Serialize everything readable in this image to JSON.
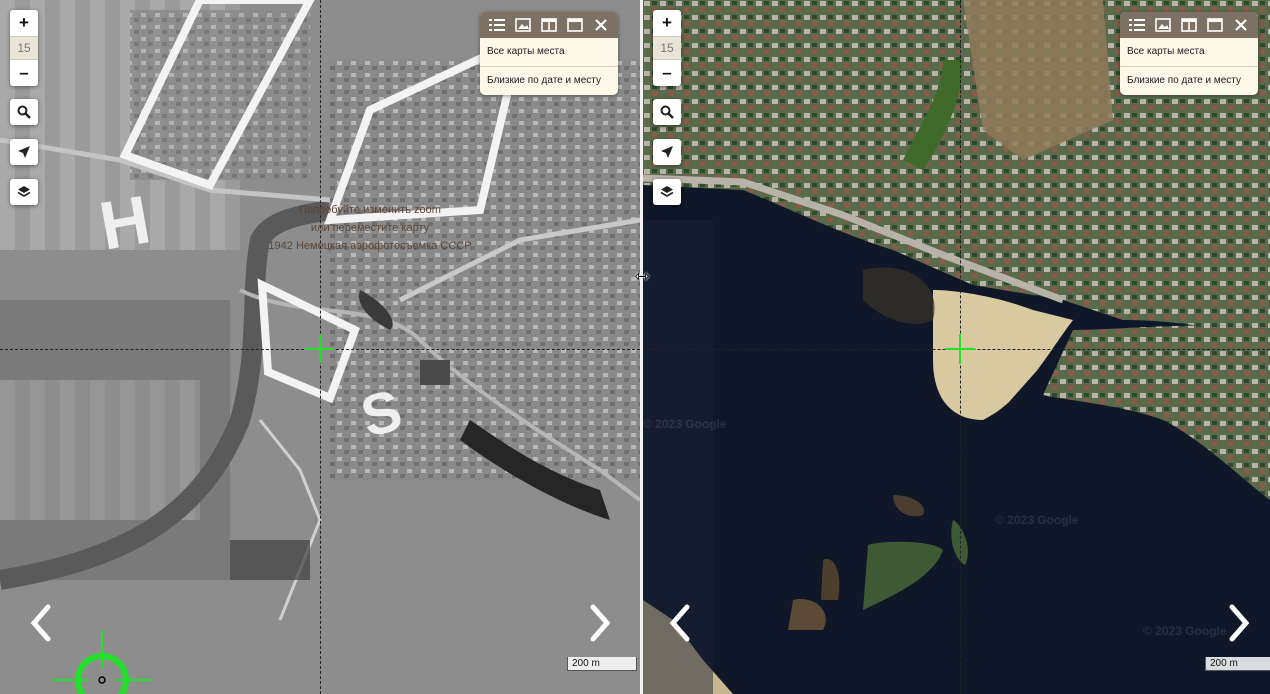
{
  "left_map": {
    "zoom_in": "+",
    "zoom_level": "15",
    "zoom_out": "–",
    "hint_lines": [
      "Попробуйте изменить zoom",
      "или переместите карту",
      "1942 Немецкая аэрофотосъемка СССР"
    ],
    "scale_label": "200 m",
    "panel": {
      "link_all_maps": "Все карты места",
      "link_nearby": "Близкие по дате и месту"
    }
  },
  "right_map": {
    "zoom_in": "+",
    "zoom_level": "15",
    "zoom_out": "–",
    "scale_label": "200 m",
    "watermark": "© 2023 Google",
    "panel": {
      "link_all_maps": "Все карты места",
      "link_nearby": "Близкие по дате и месту"
    }
  },
  "split_handle_glyph": "⇿",
  "colors": {
    "crosshair_green": "#22e02a",
    "panel_header": "#7d7163",
    "panel_bg": "#fdf8e8"
  },
  "icons": [
    "search-icon",
    "locate-icon",
    "layers-icon",
    "list-icon",
    "image-icon",
    "split-view-icon",
    "window-icon",
    "close-icon",
    "prev-arrow-icon",
    "next-arrow-icon"
  ]
}
